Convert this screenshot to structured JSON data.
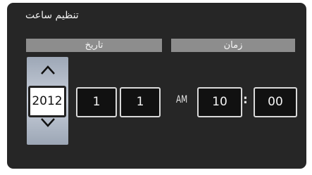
{
  "screen": {
    "title": "تنظيم ساعت"
  },
  "date": {
    "header": "تاريخ",
    "year": "2012",
    "month": "1",
    "day": "1"
  },
  "time": {
    "header": "زمان",
    "ampm": "AM",
    "hour": "10",
    "separator": ":",
    "minute": "00"
  },
  "colors": {
    "background": "#262626",
    "header_bar": "#8d8d8d",
    "selector": "#c9d0db"
  }
}
